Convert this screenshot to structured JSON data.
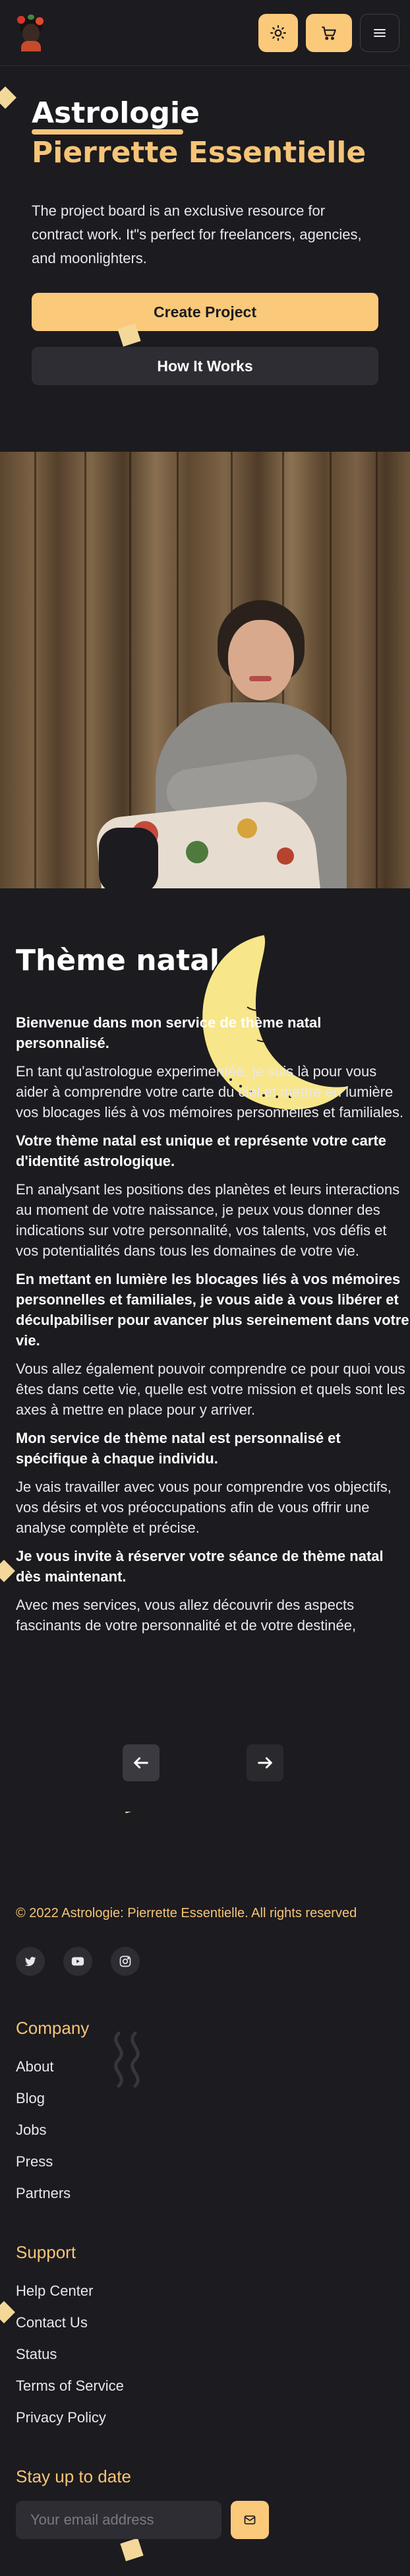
{
  "header": {
    "logo_alt": "Astrologie logo",
    "theme_toggle_icon": "sun-icon",
    "cart_icon": "cart-icon",
    "menu_icon": "hamburger-menu-icon"
  },
  "hero": {
    "title_line1": "Astrologie",
    "title_line2": "Pierrette Essentielle",
    "description": "The project board is an exclusive resource for contract work. It\"s perfect for freelancers, agencies, and moonlighters.",
    "primary_button": "Create Project",
    "secondary_button": "How It Works"
  },
  "natal": {
    "title": "Thème natal",
    "paragraphs": [
      {
        "text": "Bienvenue dans mon service de thème natal personnalisé.",
        "bold": true
      },
      {
        "text": "En tant qu'astrologue experimentée, je suis là pour vous aider à comprendre votre carte du ciel et mettre en lumière vos blocages liés à vos mémoires personnelles et familiales.",
        "bold": false
      },
      {
        "text": "Votre thème natal est unique et représente votre carte d'identité astrologique.",
        "bold": true
      },
      {
        "text": "En analysant les positions des planètes et leurs interactions au moment de votre naissance, je peux vous donner des indications sur votre personnalité, vos talents, vos défis et vos potentialités dans tous les domaines de votre vie.",
        "bold": false
      },
      {
        "text": "En mettant en lumière les blocages liés à vos mémoires personnelles et familiales, je vous aide à vous libérer et déculpabiliser pour avancer plus sereinement dans votre vie.",
        "bold": true
      },
      {
        "text": "Vous allez également pouvoir comprendre ce pour quoi vous êtes dans cette vie, quelle est votre mission et quels sont les axes à mettre en place pour y arriver.",
        "bold": false
      },
      {
        "text": "Mon service de thème natal est personnalisé et spécifique à chaque individu.",
        "bold": true
      },
      {
        "text": "Je vais travailler avec vous pour comprendre vos objectifs, vos désirs et vos préoccupations afin de vous offrir une analyse complète et précise.",
        "bold": false
      },
      {
        "text": "Je vous invite à réserver votre séance de thème natal dès maintenant.",
        "bold": true
      },
      {
        "text": "Avec mes services, vous allez découvrir des aspects fascinants de votre personnalité et de votre destinée,",
        "bold": false
      }
    ],
    "prev_icon": "arrow-left-icon",
    "next_icon": "arrow-right-icon"
  },
  "footer": {
    "copyright": "© 2022 Astrologie: Pierrette Essentielle. All rights reserved",
    "socials": [
      "twitter-icon",
      "youtube-icon",
      "instagram-icon"
    ],
    "company": {
      "title": "Company",
      "links": [
        "About",
        "Blog",
        "Jobs",
        "Press",
        "Partners"
      ]
    },
    "support": {
      "title": "Support",
      "links": [
        "Help Center",
        "Contact Us",
        "Status",
        "Terms of Service",
        "Privacy Policy"
      ]
    },
    "newsletter": {
      "title": "Stay up to date",
      "placeholder": "Your email address",
      "submit_icon": "mail-icon"
    }
  },
  "colors": {
    "background": "#1c1b1f",
    "accent": "#fbc97a",
    "accent_text": "#f6c477",
    "surface": "#2e2d33"
  }
}
